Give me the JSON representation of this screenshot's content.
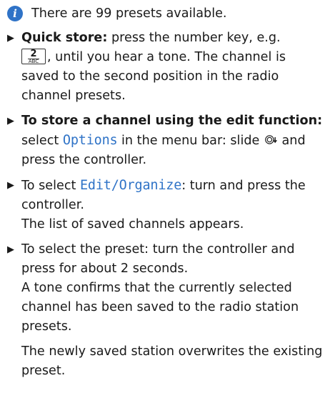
{
  "colors": {
    "accent": "#2f73c7",
    "menu": "#2f73c7",
    "text": "#1a1a1a"
  },
  "info": {
    "icon": "info-icon",
    "text": "There are 99 presets available."
  },
  "steps": [
    {
      "bold_lead": "Quick store:",
      "text_before_key": " press the number key, e.g.",
      "key": {
        "number": "2",
        "letters": "ABC"
      },
      "text_after_key": ", until you hear a tone. The channel is saved to the second position in the radio channel presets."
    },
    {
      "bold_lead": "To store a channel using the edit function:",
      "text_before_menu": " select ",
      "menu_item": "Options",
      "text_after_menu": " in the menu bar: slide ",
      "controller_icon": "controller-slide-down-icon",
      "text_end": " and press the controller."
    },
    {
      "text_before_menu": "To select ",
      "menu_item": "Edit/Organize",
      "text_after_menu": ": turn and press the controller.",
      "result": "The list of saved channels appears."
    },
    {
      "text": "To select the preset: turn the controller and press for about 2 seconds.",
      "result": "A tone confirms that the currently selected channel has been saved to the radio station presets."
    }
  ],
  "trailing_text": "The newly saved station overwrites the existing preset."
}
